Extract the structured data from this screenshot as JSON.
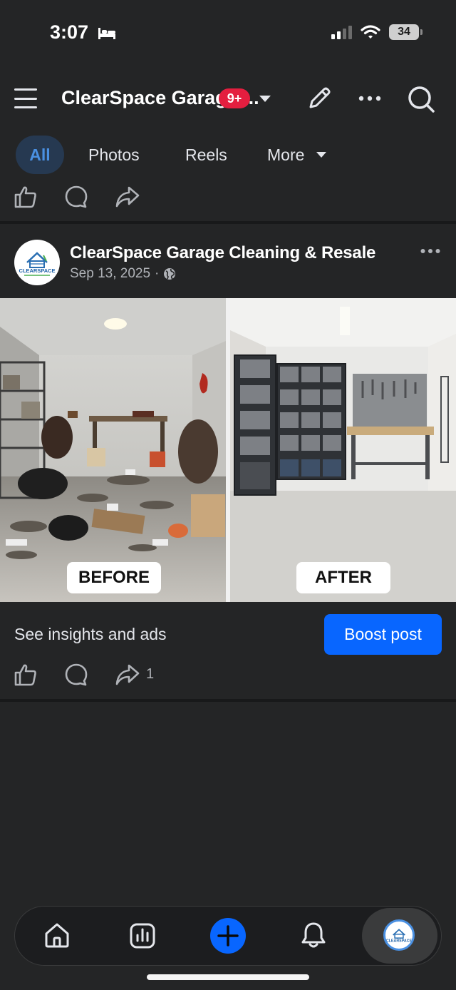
{
  "status_bar": {
    "time": "3:07",
    "battery": "34"
  },
  "header": {
    "title": "ClearSpace Garage ...",
    "notification_badge": "9+"
  },
  "filter_tabs": {
    "all": "All",
    "photos": "Photos",
    "reels": "Reels",
    "more": "More"
  },
  "post": {
    "author": "ClearSpace Garage Cleaning & Resale",
    "date": "Sep 13, 2025",
    "separator": "·",
    "photo_labels": {
      "before": "BEFORE",
      "after": "AFTER"
    },
    "insights_text": "See insights and ads",
    "boost_label": "Boost post",
    "share_count": "1"
  },
  "logo_text": "CLEARSPACE",
  "icons": [
    "bed-icon",
    "signal-icon",
    "wifi-icon",
    "menu-icon",
    "chevron-down-icon",
    "pencil-icon",
    "more-dots-icon",
    "search-icon",
    "like-icon",
    "comment-icon",
    "share-icon",
    "globe-icon",
    "home-icon",
    "insights-icon",
    "plus-icon",
    "bell-icon"
  ],
  "colors": {
    "background": "#242526",
    "accent": "#0866ff",
    "badge": "#e41e3f",
    "tab_active_bg": "#263951",
    "tab_active_text": "#4a90e2"
  }
}
